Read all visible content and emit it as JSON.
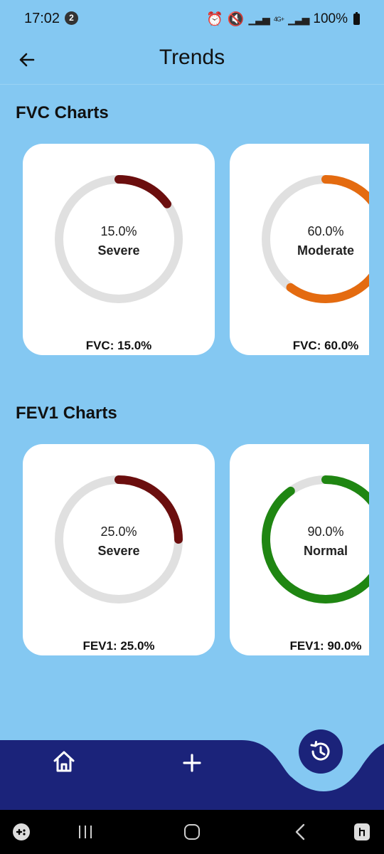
{
  "status_bar": {
    "time": "17:02",
    "notification_count": "2",
    "net_label": "4G+",
    "battery": "100%"
  },
  "app_bar": {
    "title": "Trends"
  },
  "colors": {
    "background": "#84c8f2",
    "severe": "#6b0e0e",
    "moderate": "#e46b10",
    "normal": "#1f8612",
    "track": "#e0e0e0",
    "nav": "#1b237a"
  },
  "sections": [
    {
      "title": "FVC Charts",
      "cards": [
        {
          "percent_text": "15.0%",
          "value": 15,
          "severity": "Severe",
          "footer": "FVC: 15.0%",
          "color": "#6b0e0e"
        },
        {
          "percent_text": "60.0%",
          "value": 60,
          "severity": "Moderate",
          "footer": "FVC: 60.0%",
          "color": "#e46b10"
        }
      ]
    },
    {
      "title": "FEV1 Charts",
      "cards": [
        {
          "percent_text": "25.0%",
          "value": 25,
          "severity": "Severe",
          "footer": "FEV1: 25.0%",
          "color": "#6b0e0e"
        },
        {
          "percent_text": "90.0%",
          "value": 90,
          "severity": "Normal",
          "footer": "FEV1: 90.0%",
          "color": "#1f8612"
        }
      ]
    }
  ],
  "bottom_nav": {
    "items": [
      {
        "icon": "home-icon"
      },
      {
        "icon": "plus-icon"
      },
      {
        "icon": "history-icon"
      }
    ]
  }
}
